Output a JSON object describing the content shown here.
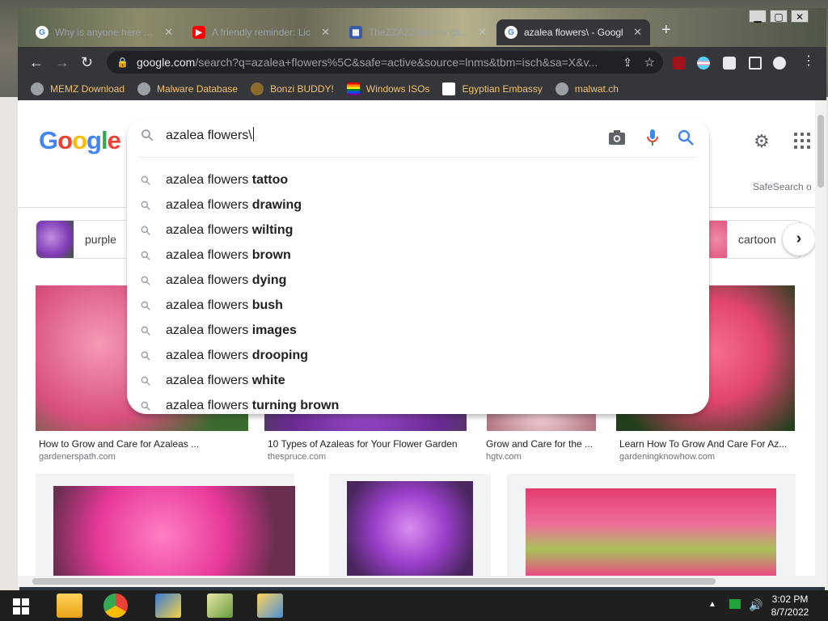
{
  "tabs": [
    {
      "title": "Why is anyone here more",
      "favicon": "google"
    },
    {
      "title": "A friendly reminder: Lic",
      "favicon": "youtube"
    },
    {
      "title": "TheZZAZZGlitch's glitch",
      "favicon": "wiki"
    },
    {
      "title": "azalea flowers\\ - Googl",
      "favicon": "google",
      "active": true
    }
  ],
  "toolbar": {
    "url_host": "google.com",
    "url_path": "/search?q=azalea+flowers%5C&safe=active&source=lnms&tbm=isch&sa=X&v..."
  },
  "bookmarks": [
    {
      "label": "MEMZ Download"
    },
    {
      "label": "Malware Database"
    },
    {
      "label": "Bonzi BUDDY!"
    },
    {
      "label": "Windows ISOs"
    },
    {
      "label": "Egyptian Embassy"
    },
    {
      "label": "malwat.ch"
    }
  ],
  "google": {
    "safesearch": "SafeSearch o",
    "query": "azalea flowers\\",
    "suggestion_prefix": "azalea flowers",
    "suggestions": [
      "tattoo",
      "drawing",
      "wilting",
      "brown",
      "dying",
      "bush",
      "images",
      "drooping",
      "white",
      "turning brown"
    ],
    "chips": [
      "purple",
      "cartoon"
    ]
  },
  "results": [
    {
      "caption": "How to Grow and Care for Azaleas ...",
      "source": "gardenerspath.com"
    },
    {
      "caption": "10 Types of Azaleas for Your Flower Garden",
      "source": "thespruce.com"
    },
    {
      "caption": "Grow and Care for the ...",
      "source": "hgtv.com"
    },
    {
      "caption": "Learn How To Grow And Care For Az...",
      "source": "gardeningknowhow.com"
    }
  ],
  "clock": {
    "time": "3:02 PM",
    "date": "8/7/2022"
  },
  "colors": {
    "accent_blue": "#4285f4",
    "bookmark_text": "#f5c26b"
  }
}
